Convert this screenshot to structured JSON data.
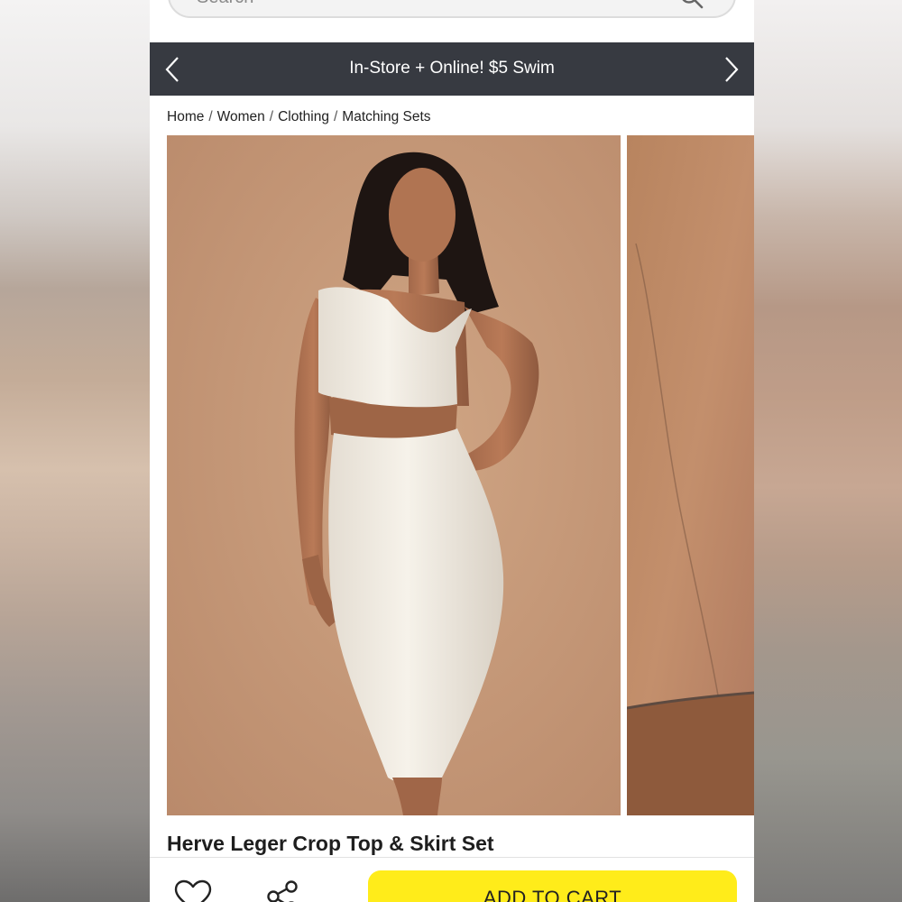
{
  "search": {
    "placeholder": "Search"
  },
  "promo": {
    "text": "In-Store + Online! $5 Swim"
  },
  "breadcrumb": [
    "Home",
    "Women",
    "Clothing",
    "Matching Sets"
  ],
  "breadcrumb_separator": "/",
  "product": {
    "title": "Herve Leger Crop Top & Skirt Set"
  },
  "actions": {
    "add_to_cart": "ADD TO CART"
  },
  "icons": {
    "search": "search-icon",
    "prev": "chevron-left-icon",
    "next": "chevron-right-icon",
    "favorite": "heart-icon",
    "share": "share-icon"
  },
  "colors": {
    "promo_bg": "#373a41",
    "cta_bg": "#ffec1a",
    "photo_bg": "#c69a78",
    "garment": "#f1ece3"
  }
}
